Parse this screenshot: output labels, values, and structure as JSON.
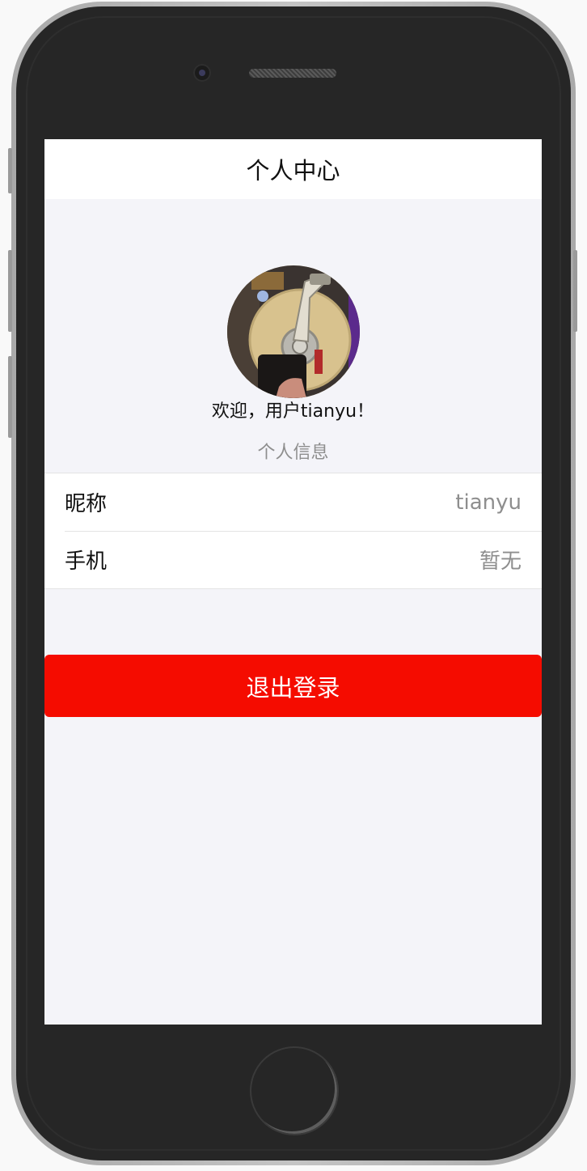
{
  "navbar": {
    "title": "个人中心"
  },
  "profile": {
    "avatar_icon": "hard-drive-photo-avatar",
    "welcome": "欢迎，用户tianyu！",
    "section_label": "个人信息"
  },
  "info_list": [
    {
      "label": "昵称",
      "value": "tianyu"
    },
    {
      "label": "手机",
      "value": "暂无"
    }
  ],
  "actions": {
    "logout_label": "退出登录"
  },
  "colors": {
    "accent_red": "#f50c00",
    "screen_bg": "#f4f4f9",
    "secondary_text": "#8e8e8e"
  }
}
